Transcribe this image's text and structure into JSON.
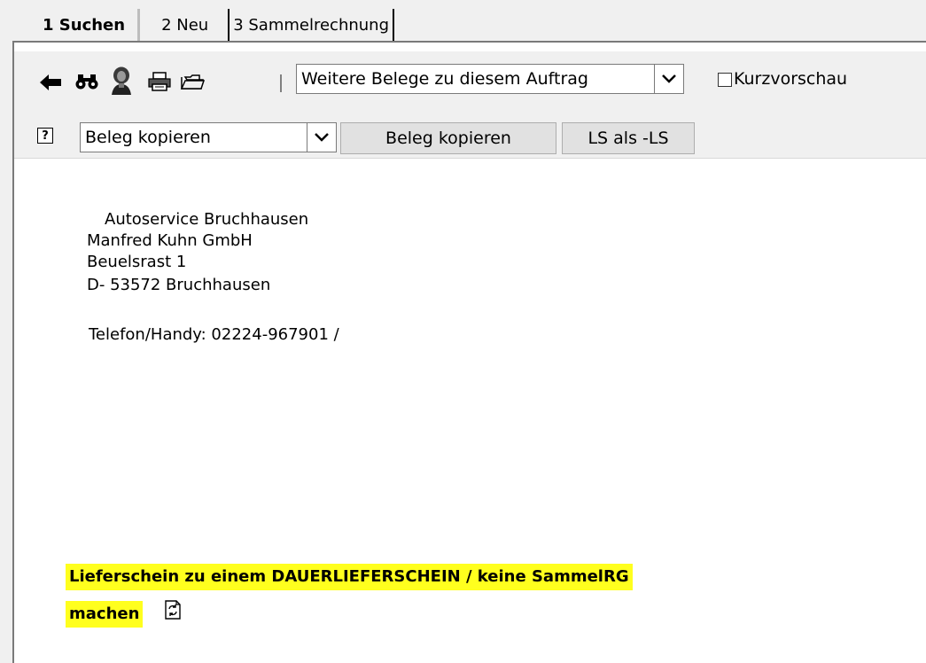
{
  "tabs": [
    {
      "label": "1 Suchen"
    },
    {
      "label": "2 Neu"
    },
    {
      "label": "3 Sammelrechnung"
    }
  ],
  "toolbar": {
    "icons": [
      "back-arrow-icon",
      "binoculars-icon",
      "person-icon",
      "printer-icon",
      "folder-icon"
    ],
    "separator": "|",
    "belege_select": "Weitere Belege zu diesem Auftrag",
    "kurzvorschau_label": "Kurzvorschau",
    "kurzvorschau_checked": false
  },
  "actions": {
    "help_label": "?",
    "action_select": "Beleg kopieren",
    "copy_button": "Beleg kopieren",
    "ls_button": "LS als -LS"
  },
  "address": {
    "line1": "Autoservice Bruchhausen",
    "line2": "Manfred Kuhn GmbH",
    "line3": "Beuelsrast 1",
    "line4": "D- 53572  Bruchhausen",
    "phone": "Telefon/Handy: 02224-967901 /"
  },
  "notice": {
    "line1": "Lieferschein zu einem DAUERLIEFERSCHEIN / keine SammelRG",
    "line2": "machen",
    "highlight_color": "#ffff1e"
  }
}
